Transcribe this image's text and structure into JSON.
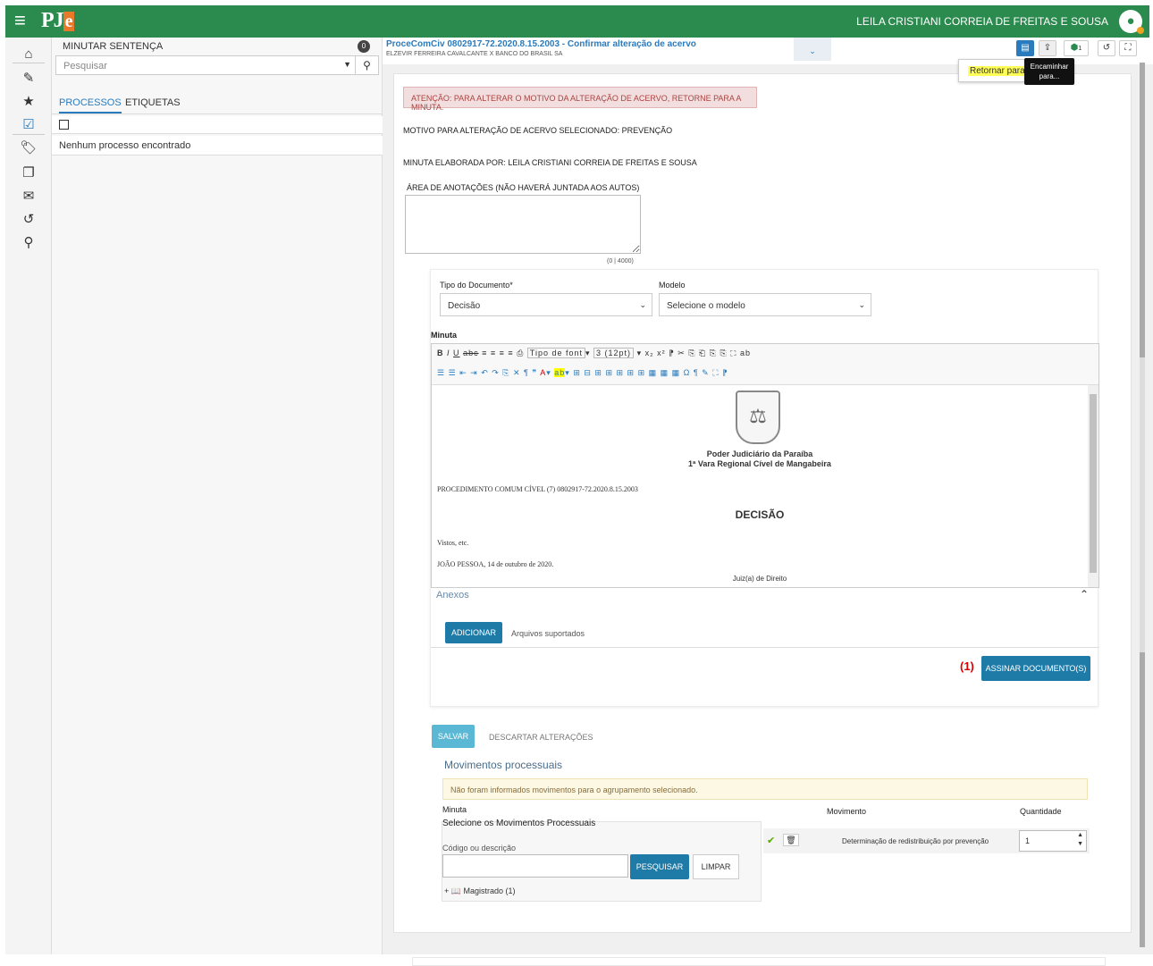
{
  "topbar": {
    "logo_p": "PJ",
    "logo_e": "e",
    "user": "LEILA CRISTIANI CORREIA DE FREITAS E SOUSA"
  },
  "left": {
    "title": "MINUTAR SENTENÇA",
    "count": "0",
    "search_placeholder": "Pesquisar",
    "tabs": [
      "PROCESSOS",
      "ETIQUETAS"
    ],
    "empty": "Nenhum processo encontrado"
  },
  "header": {
    "title": "ProceComCiv 0802917-72.2020.8.15.2003 - Confirmar alteração de acervo",
    "parties": "ELZEVIR FERREIRA CAVALCANTE X BANCO DO BRASIL SA",
    "tag_count": "1"
  },
  "tooltips": {
    "retornar": "Retornar para m",
    "encaminhar": "Encaminhar para..."
  },
  "form": {
    "alert": "ATENÇÃO: PARA ALTERAR O MOTIVO DA ALTERAÇÃO DE ACERVO, RETORNE PARA A MINUTA.",
    "motivo": "MOTIVO PARA ALTERAÇÃO DE ACERVO SELECIONADO: PREVENÇÃO",
    "elaborada": "MINUTA ELABORADA POR: LEILA CRISTIANI CORREIA DE FREITAS E SOUSA",
    "anotacoes_label": "ÁREA DE ANOTAÇÕES (NÃO HAVERÁ JUNTADA AOS AUTOS)",
    "counter": "(0 | 4000)",
    "tipo_label": "Tipo do Documento*",
    "tipo_value": "Decisão",
    "modelo_label": "Modelo",
    "modelo_value": "Selecione o modelo",
    "minuta_label": "Minuta",
    "font_select": "Tipo de font",
    "size_select": "3 (12pt)"
  },
  "doc": {
    "court1": "Poder Judiciário da Paraíba",
    "court2": "1ª Vara Regional Cível de Mangabeira",
    "proc": "PROCEDIMENTO COMUM CÍVEL (7) 0802917-72.2020.8.15.2003",
    "heading": "DECISÃO",
    "vistos": "Vistos, etc.",
    "local": "JOÃO PESSOA, 14 de outubro de 2020.",
    "juiz": "Juiz(a) de Direito"
  },
  "anexos": {
    "title": "Anexos",
    "adicionar": "ADICIONAR",
    "suportados": "Arquivos suportados",
    "marker": "(1)",
    "assinar": "ASSINAR DOCUMENTO(S)"
  },
  "actions": {
    "salvar": "SALVAR",
    "descartar": "DESCARTAR ALTERAÇÕES"
  },
  "movimentos": {
    "title": "Movimentos processuais",
    "warn": "Não foram informados movimentos para o agrupamento selecionado.",
    "col_minuta": "Minuta",
    "col_movimento": "Movimento",
    "col_qtd": "Quantidade",
    "selecione": "Selecione os Movimentos Processuais",
    "codigo_label": "Código ou descrição",
    "pesquisar": "PESQUISAR",
    "limpar": "LIMPAR",
    "tree_item": "Magistrado (1)",
    "row_mov": "Determinação de redistribuição por prevenção",
    "row_qtd": "1"
  }
}
